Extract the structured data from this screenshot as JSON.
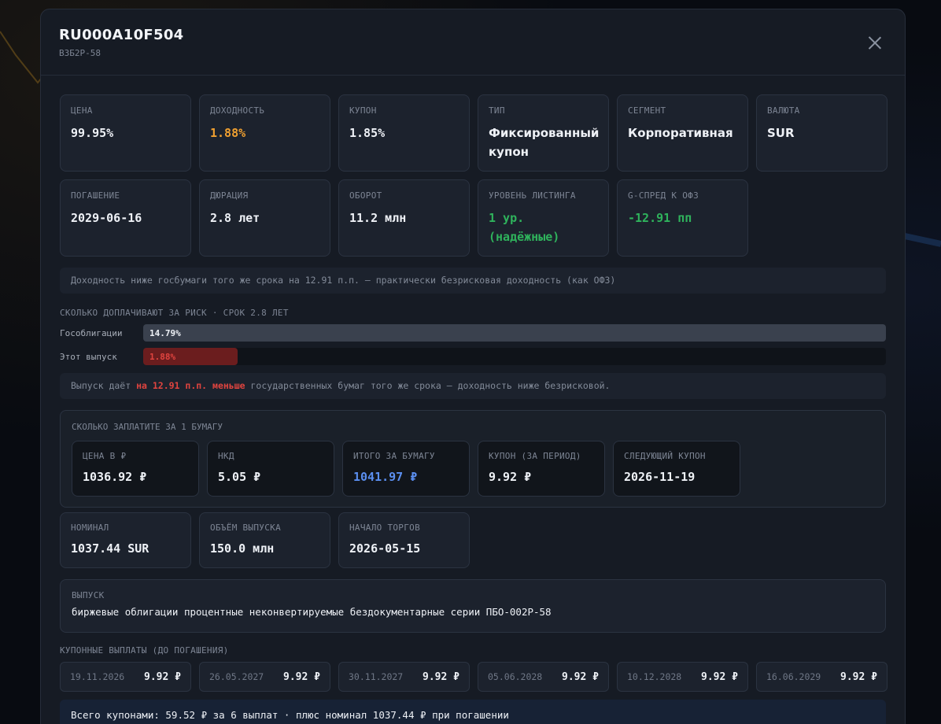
{
  "header": {
    "title": "RU000A10F504",
    "subtitle": "ВЗБ2Р-58"
  },
  "metrics_row1": [
    {
      "label": "ЦЕНА",
      "value": "99.95%"
    },
    {
      "label": "ДОХОДНОСТЬ",
      "value": "1.88%"
    },
    {
      "label": "КУПОН",
      "value": "1.85%"
    },
    {
      "label": "ТИП",
      "value": "Фиксированный купон"
    },
    {
      "label": "СЕГМЕНТ",
      "value": "Корпоративная"
    },
    {
      "label": "ВАЛЮТА",
      "value": "SUR"
    }
  ],
  "metrics_row2": [
    {
      "label": "ПОГАШЕНИЕ",
      "value": "2029-06-16"
    },
    {
      "label": "ДЮРАЦИЯ",
      "value": "2.8 лет"
    },
    {
      "label": "ОБОРОТ",
      "value": "11.2 млн"
    },
    {
      "label": "УРОВЕНЬ ЛИСТИНГА",
      "value": "1 ур. (надёжные)"
    },
    {
      "label": "G-СПРЕД К ОФЗ",
      "value": "-12.91 пп"
    }
  ],
  "spread_note": "Доходность ниже госбумаги того же срока на 12.91 п.п. — практически безрисковая доходность (как ОФЗ)",
  "risk": {
    "title": "СКОЛЬКО ДОПЛАЧИВАЮТ ЗА РИСК · СРОК 2.8 ЛЕТ",
    "bars": [
      {
        "name": "Гособлигации",
        "label": "14.79%",
        "value": 14.79
      },
      {
        "name": "Этот выпуск",
        "label": "1.88%",
        "value": 1.88
      }
    ],
    "note_prefix": "Выпуск даёт ",
    "note_highlight": "на 12.91 п.п. меньше",
    "note_suffix": " государственных бумаг того же срока — доходность ниже безрисковой."
  },
  "payment": {
    "title": "СКОЛЬКО ЗАПЛАТИТЕ ЗА 1 БУМАГУ",
    "items": [
      {
        "label": "ЦЕНА В ₽",
        "value": "1036.92 ₽"
      },
      {
        "label": "НКД",
        "value": "5.05 ₽"
      },
      {
        "label": "ИТОГО ЗА БУМАГУ",
        "value": "1041.97 ₽"
      },
      {
        "label": "КУПОН (ЗА ПЕРИОД)",
        "value": "9.92 ₽"
      },
      {
        "label": "СЛЕДУЮЩИЙ КУПОН",
        "value": "2026-11-19"
      }
    ]
  },
  "details": [
    {
      "label": "НОМИНАЛ",
      "value": "1037.44 SUR"
    },
    {
      "label": "ОБЪЁМ ВЫПУСКА",
      "value": "150.0 млн"
    },
    {
      "label": "НАЧАЛО ТОРГОВ",
      "value": "2026-05-15"
    }
  ],
  "issue": {
    "label": "ВЫПУСК",
    "value": "биржевые облигации процентные неконвертируемые бездокументарные серии ПБО-002Р-58"
  },
  "coupons": {
    "title": "КУПОННЫЕ ВЫПЛАТЫ (ДО ПОГАШЕНИЯ)",
    "items": [
      {
        "date": "19.11.2026",
        "amount": "9.92 ₽"
      },
      {
        "date": "26.05.2027",
        "amount": "9.92 ₽"
      },
      {
        "date": "30.11.2027",
        "amount": "9.92 ₽"
      },
      {
        "date": "05.06.2028",
        "amount": "9.92 ₽"
      },
      {
        "date": "10.12.2028",
        "amount": "9.92 ₽"
      },
      {
        "date": "16.06.2029",
        "amount": "9.92 ₽"
      }
    ],
    "total": "Всего купонами: 59.52 ₽ за 6 выплат · плюс номинал 1037.44 ₽ при погашении"
  },
  "colors": {
    "accent_orange": "#f0a030",
    "positive_green": "#2fb35c",
    "negative_red": "#e0443f",
    "accent_blue": "#5b8ff0"
  },
  "icons": {
    "close": "close-icon"
  }
}
